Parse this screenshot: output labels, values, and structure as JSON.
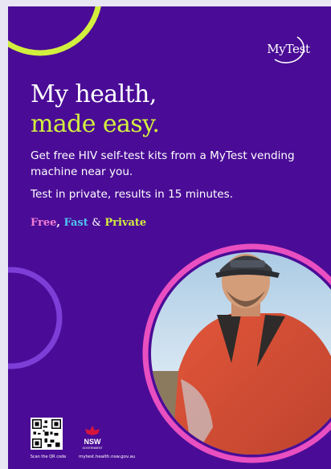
{
  "brand": {
    "logo_text": "MyTest"
  },
  "headline": {
    "line1": "My health,",
    "line2": "made easy."
  },
  "body": {
    "paragraph1": "Get free HIV self-test kits from a MyTest vending machine near you.",
    "paragraph2": "Test in private, results in 15 minutes."
  },
  "tagline": {
    "free": "Free",
    "comma": ",",
    "fast": "Fast",
    "amp": "&",
    "private": "Private"
  },
  "footer": {
    "qr_caption": "Scan the QR code",
    "nsw_label": "NSW",
    "nsw_sublabel": "GOVERNMENT",
    "url": "mytest.health.nsw.gov.au"
  },
  "colors": {
    "background": "#4a0c96",
    "accent_lime": "#d3ef3e",
    "accent_pink": "#f07cd4",
    "accent_blue": "#4fc3f0",
    "ring_purple": "#7c3ed6"
  },
  "icons": [
    "qr-code-icon",
    "nsw-waratah-icon",
    "mytest-logo-icon"
  ]
}
